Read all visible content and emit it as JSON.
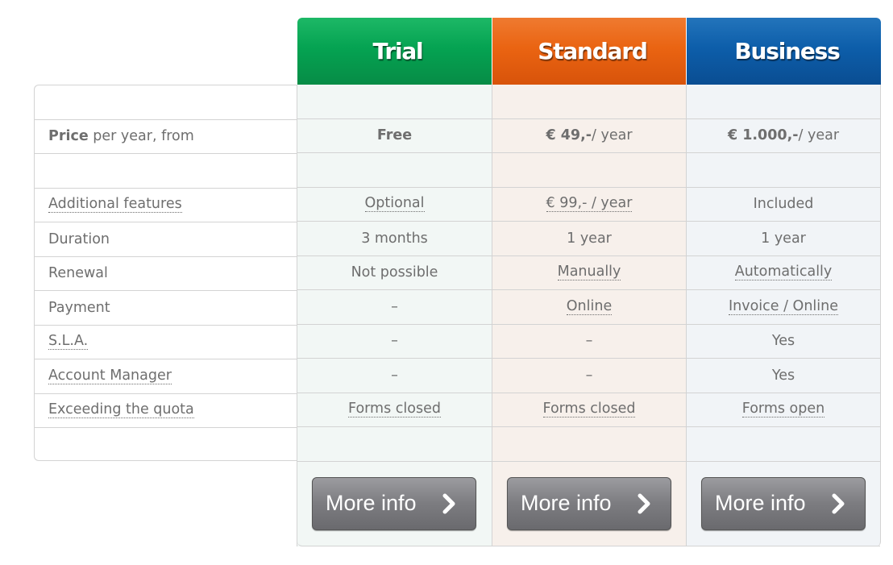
{
  "plans": [
    {
      "name": "Trial",
      "color": "#05a352"
    },
    {
      "name": "Standard",
      "color": "#ea6412"
    },
    {
      "name": "Business",
      "color": "#0d5eaa"
    }
  ],
  "rows": [
    {
      "label": "",
      "label_bold": "",
      "label_dotted": false,
      "values": [
        "",
        "",
        ""
      ]
    },
    {
      "label": "per year, from",
      "label_bold": "Price",
      "label_dotted": false,
      "values": [
        {
          "bold": "Free",
          "rest": ""
        },
        {
          "bold": "€ 49,-",
          "rest": " / year"
        },
        {
          "bold": "€ 1.000,-",
          "rest": " / year"
        }
      ]
    },
    {
      "label": "",
      "label_bold": "",
      "label_dotted": false,
      "values": [
        "",
        "",
        ""
      ]
    },
    {
      "label": "Additional features",
      "label_dotted": true,
      "values": [
        {
          "text": "Optional",
          "dotted": true
        },
        {
          "text": "€ 99,- / year",
          "dotted": true
        },
        {
          "text": "Included",
          "dotted": false
        }
      ]
    },
    {
      "label": "Duration",
      "label_dotted": false,
      "values": [
        {
          "text": "3 months",
          "dotted": false
        },
        {
          "text": "1 year",
          "dotted": false
        },
        {
          "text": "1 year",
          "dotted": false
        }
      ]
    },
    {
      "label": "Renewal",
      "label_dotted": false,
      "values": [
        {
          "text": "Not possible",
          "dotted": false
        },
        {
          "text": "Manually",
          "dotted": true
        },
        {
          "text": "Automatically",
          "dotted": true
        }
      ]
    },
    {
      "label": "Payment",
      "label_dotted": false,
      "values": [
        {
          "text": "–",
          "dotted": false
        },
        {
          "text": "Online",
          "dotted": true
        },
        {
          "text": "Invoice / Online",
          "dotted": true
        }
      ]
    },
    {
      "label": "S.L.A.",
      "label_dotted": true,
      "values": [
        {
          "text": "–",
          "dotted": false
        },
        {
          "text": "–",
          "dotted": false
        },
        {
          "text": "Yes",
          "dotted": false
        }
      ]
    },
    {
      "label": "Account Manager",
      "label_dotted": true,
      "values": [
        {
          "text": "–",
          "dotted": false
        },
        {
          "text": "–",
          "dotted": false
        },
        {
          "text": "Yes",
          "dotted": false
        }
      ]
    },
    {
      "label": "Exceeding the quota",
      "label_dotted": true,
      "values": [
        {
          "text": "Forms closed",
          "dotted": true
        },
        {
          "text": "Forms closed",
          "dotted": true
        },
        {
          "text": "Forms open",
          "dotted": true
        }
      ]
    },
    {
      "label": "",
      "label_dotted": false,
      "values": [
        "",
        "",
        ""
      ]
    }
  ],
  "buttons": {
    "more_info_label": "More info",
    "icon": "chevron-right-icon"
  }
}
